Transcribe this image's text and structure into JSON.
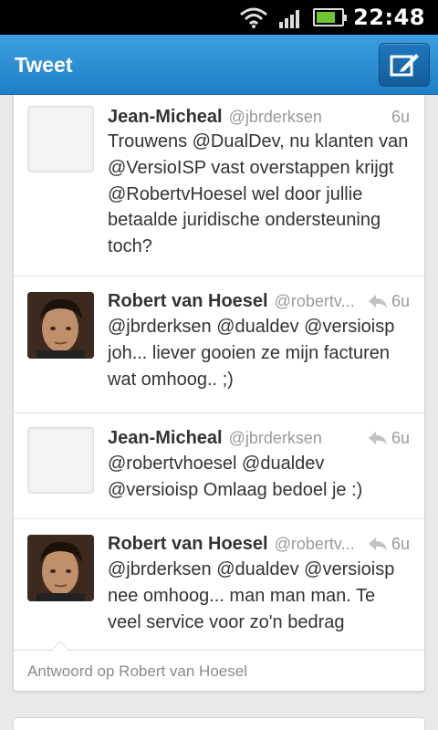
{
  "status_bar": {
    "time": "22:48",
    "battery_level": 0.7,
    "battery_color": "#6ec631"
  },
  "action_bar": {
    "title": "Tweet",
    "compose_icon": "compose-icon",
    "accent": "#2b8ad2"
  },
  "tweets": [
    {
      "name": "Jean-Micheal",
      "handle": "@jbrderksen",
      "time": "6u",
      "show_reply": false,
      "avatar": "blank",
      "text": "Trouwens @DualDev, nu klanten van @VersioISP vast overstappen krijgt @RobertvHoesel wel door jullie betaalde juridische ondersteuning toch?"
    },
    {
      "name": "Robert van Hoesel",
      "handle": "@robertv...",
      "time": "6u",
      "show_reply": true,
      "avatar": "photo",
      "text": "@jbrderksen @dualdev @versioisp joh... liever gooien ze mijn facturen wat omhoog.. ;)"
    },
    {
      "name": "Jean-Micheal",
      "handle": "@jbrderksen",
      "time": "6u",
      "show_reply": true,
      "avatar": "blank",
      "text": "@robertvhoesel @dualdev @versioisp Omlaag bedoel je :)"
    },
    {
      "name": "Robert van Hoesel",
      "handle": "@robertv...",
      "time": "6u",
      "show_reply": true,
      "avatar": "photo",
      "text": "@jbrderksen @dualdev @versioisp nee omhoog... man man man. Te veel service voor zo'n bedrag"
    }
  ],
  "reply_footer": {
    "label": "Antwoord op Robert van Hoesel"
  }
}
